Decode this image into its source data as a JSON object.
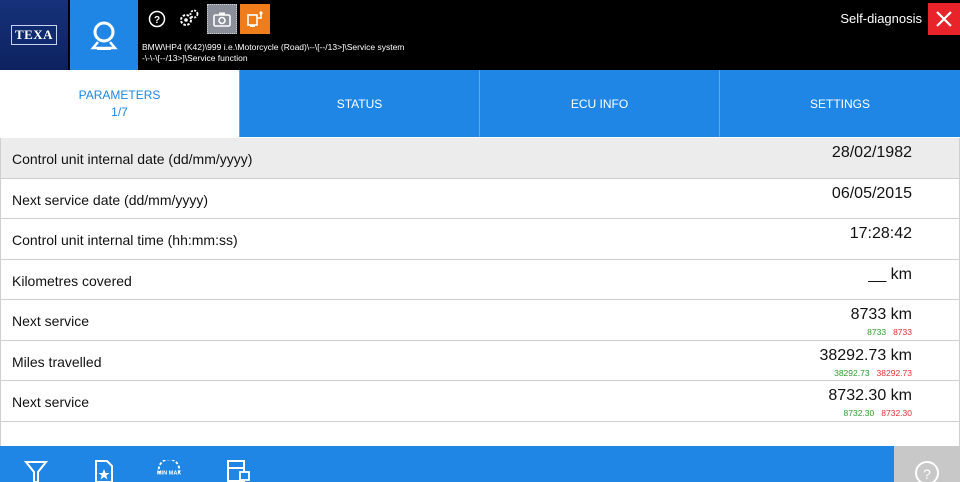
{
  "header": {
    "logo_text": "TEXA",
    "breadcrumb_line1": "BMW\\HP4 (K42)\\999 i.e.\\Motorcycle (Road)\\--\\[--/13>]\\Service system",
    "breadcrumb_line2": "-\\-\\-\\[--/13>]\\Service function",
    "mode_title": "Self-diagnosis",
    "icons": [
      "search-icon",
      "help-icon",
      "settings-icon",
      "camera-icon",
      "vehicle-icon",
      "close-icon"
    ],
    "accent_color": "#1f86e6",
    "close_color": "#e8232a",
    "vehicle_button_color": "#f07d1c"
  },
  "tabs": [
    {
      "label": "PARAMETERS",
      "sub": "1/7",
      "active": true
    },
    {
      "label": "STATUS",
      "sub": "",
      "active": false
    },
    {
      "label": "ECU INFO",
      "sub": "",
      "active": false
    },
    {
      "label": "SETTINGS",
      "sub": "",
      "active": false
    }
  ],
  "rows": [
    {
      "label": "Control unit internal date (dd/mm/yyyy)",
      "value": "28/02/1982",
      "min": "",
      "max": ""
    },
    {
      "label": "Next service date (dd/mm/yyyy)",
      "value": "06/05/2015",
      "min": "",
      "max": ""
    },
    {
      "label": "Control unit internal time (hh:mm:ss)",
      "value": "17:28:42",
      "min": "",
      "max": ""
    },
    {
      "label": "Kilometres covered",
      "value": "__ km",
      "min": "",
      "max": ""
    },
    {
      "label": "Next service",
      "value": "8733 km",
      "min": "8733",
      "max": "8733"
    },
    {
      "label": "Miles travelled",
      "value": "38292.73 km",
      "min": "38292.73",
      "max": "38292.73"
    },
    {
      "label": "Next service",
      "value": "8732.30 km",
      "min": "8732.30",
      "max": "8732.30"
    }
  ],
  "toolbar": {
    "icons": [
      "filter-icon",
      "favorites-icon",
      "min-max-icon",
      "print-icon",
      "help-icon"
    ],
    "minmax_text": "MIN MAX"
  }
}
